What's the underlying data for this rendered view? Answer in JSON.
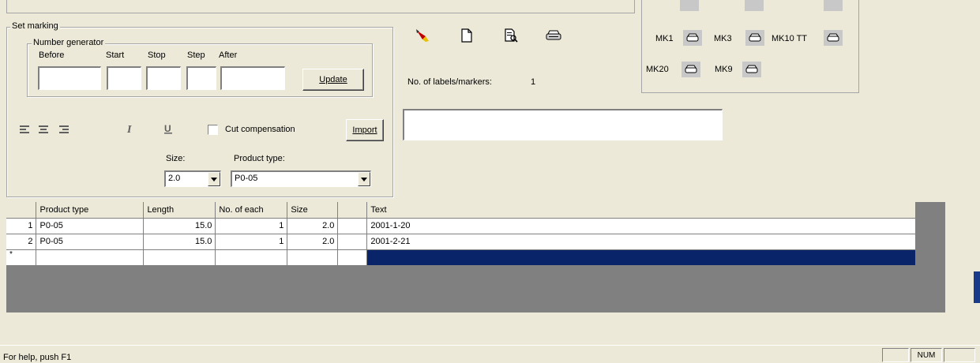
{
  "set_marking": {
    "title": "Set marking",
    "number_generator": {
      "title": "Number generator",
      "labels": {
        "before": "Before",
        "start": "Start",
        "stop": "Stop",
        "step": "Step",
        "after": "After"
      },
      "values": {
        "before": "",
        "start": "",
        "stop": "",
        "step": "",
        "after": ""
      }
    },
    "update_label": "Update",
    "cut_compensation_label": "Cut compensation",
    "cut_compensation_checked": false,
    "import_label": "Import",
    "size_label": "Size:",
    "size_value": "2.0",
    "product_type_label": "Product type:",
    "product_type_value": "P0-05"
  },
  "labels_count": {
    "label": "No. of labels/markers:",
    "value": "1"
  },
  "text_input_value": "",
  "printers": [
    {
      "label": "MK1"
    },
    {
      "label": "MK3"
    },
    {
      "label": "MK10 TT"
    },
    {
      "label": "MK20"
    },
    {
      "label": "MK9"
    }
  ],
  "grid": {
    "headers": [
      "",
      "Product type",
      "Length",
      "No. of each",
      "Size",
      "",
      "Text"
    ],
    "rows": [
      {
        "index": "1",
        "product_type": "P0-05",
        "length": "15.0",
        "each": "1",
        "size": "2.0",
        "text": "2001-1-20"
      },
      {
        "index": "2",
        "product_type": "P0-05",
        "length": "15.0",
        "each": "1",
        "size": "2.0",
        "text": "2001-2-21"
      }
    ],
    "new_row_marker": "*"
  },
  "status_bar": {
    "help": "For help, push F1",
    "num": "NUM"
  },
  "colors": {
    "face": "#ece9d8",
    "selection": "#0a246a",
    "grid_bg": "#808080"
  }
}
